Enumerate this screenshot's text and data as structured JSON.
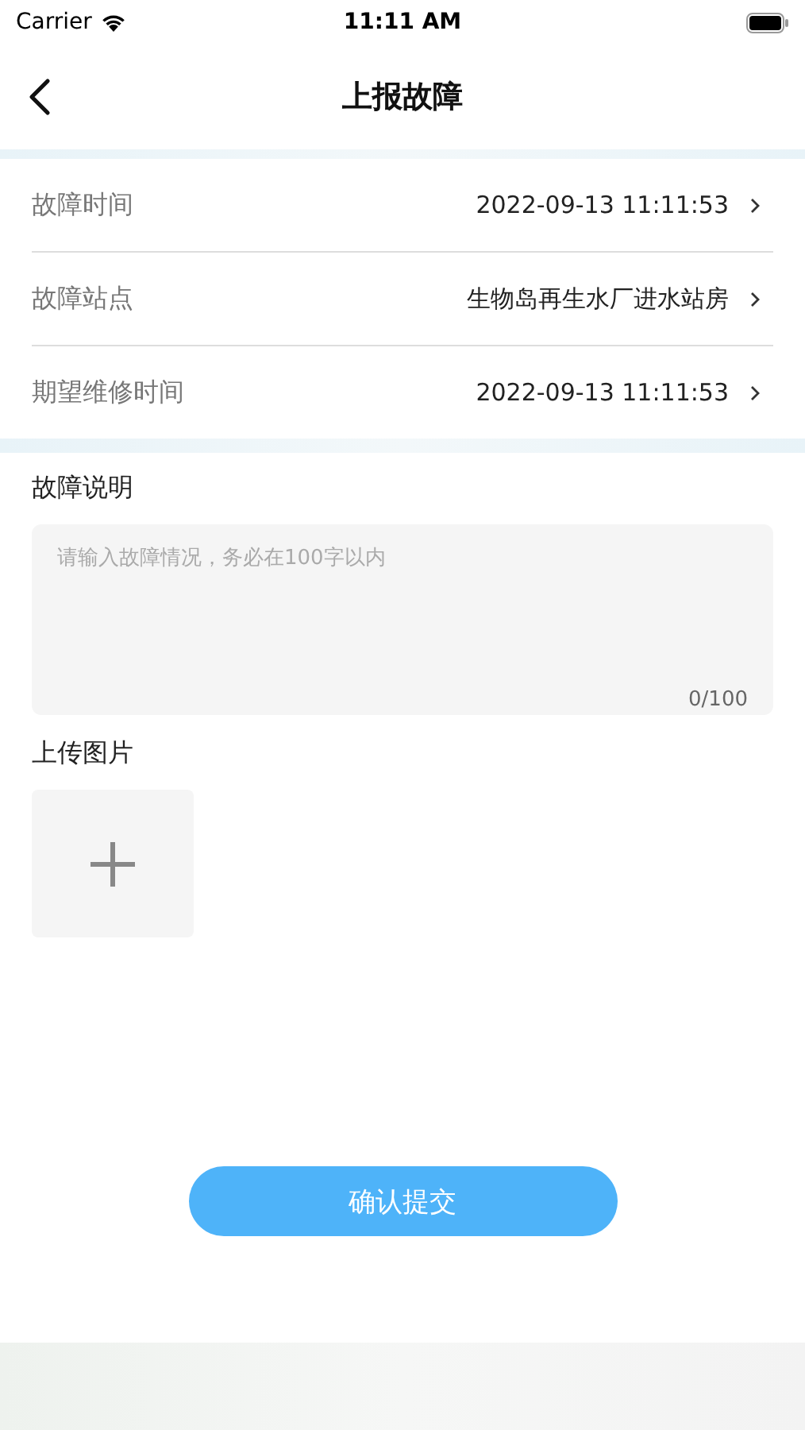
{
  "status_bar": {
    "carrier": "Carrier",
    "time": "11:11 AM"
  },
  "nav": {
    "title": "上报故障"
  },
  "rows": [
    {
      "label": "故障时间",
      "value": "2022-09-13 11:11:53"
    },
    {
      "label": "故障站点",
      "value": "生物岛再生水厂进水站房"
    },
    {
      "label": "期望维修时间",
      "value": "2022-09-13 11:11:53"
    }
  ],
  "description": {
    "label": "故障说明",
    "placeholder": "请输入故障情况，务必在100字以内",
    "counter": "0/100"
  },
  "upload": {
    "label": "上传图片"
  },
  "submit_button": "确认提交"
}
